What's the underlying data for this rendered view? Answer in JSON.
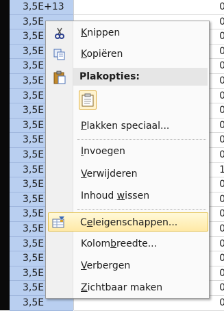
{
  "spreadsheet": {
    "column_a": [
      "3,5E+13",
      "3,5E",
      "3,5E",
      "3,5E",
      "3,5E",
      "3,5E",
      "3,5E",
      "3,5E",
      "3,5E",
      "3,5E",
      "3,5E",
      "3,5E",
      "3,5E",
      "3,5E",
      "3,5E",
      "3,5E",
      "3,5E",
      "3,5E",
      "3,5E",
      "3,5E",
      "3,5E"
    ],
    "column_b": [
      "0",
      "0",
      "0",
      "0",
      "0",
      "0",
      "0",
      "0",
      "0",
      "0",
      "0",
      "1",
      "0",
      "0",
      "0",
      "0",
      "0",
      "0",
      "0",
      "0",
      "0"
    ]
  },
  "context_menu": {
    "cut": {
      "pre": "",
      "key": "K",
      "post": "nippen",
      "icon": "scissors-icon"
    },
    "copy": {
      "pre": "",
      "key": "K",
      "post": "opiëren",
      "icon": "copy-icon"
    },
    "paste_header": {
      "label": "Plakopties:",
      "icon": "clipboard-icon"
    },
    "paste_option_icon": "paste-icon",
    "paste_special": {
      "pre": "",
      "key": "P",
      "post": "lakken speciaal..."
    },
    "insert": {
      "pre": "",
      "key": "I",
      "post": "nvoegen"
    },
    "delete": {
      "pre": "",
      "key": "V",
      "post": "erwijderen"
    },
    "clear": {
      "pre": "Inhoud ",
      "key": "w",
      "post": "issen"
    },
    "format_cells": {
      "pre": "C",
      "key": "e",
      "post": "leigenschappen...",
      "icon": "format-cells-icon"
    },
    "column_width": {
      "pre": "Kolom",
      "key": "b",
      "post": "reedte..."
    },
    "hide": {
      "pre": "",
      "key": "V",
      "post": "erbergen"
    },
    "unhide": {
      "pre": "",
      "key": "Z",
      "post": "ichtbaar maken"
    }
  },
  "colors": {
    "menu_highlight": "#ffe9a6",
    "column_selected": "#b9cff0"
  }
}
